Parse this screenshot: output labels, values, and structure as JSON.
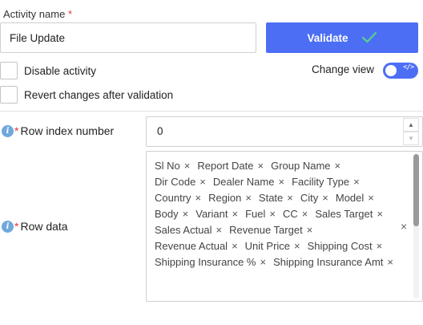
{
  "activity": {
    "label": "Activity name",
    "required_mark": "*",
    "value": "File Update"
  },
  "validate_button": {
    "label": "Validate",
    "icon": "check-icon",
    "color": "#4c6ef5"
  },
  "options": {
    "disable_activity": {
      "label": "Disable activity",
      "checked": false
    },
    "revert_changes": {
      "label": "Revert changes after validation",
      "checked": false
    }
  },
  "change_view": {
    "label": "Change view",
    "toggle_on": true,
    "toggle_icon_text": "</>"
  },
  "row_index": {
    "label": "Row index number",
    "required_mark": "*",
    "value": "0",
    "info_icon": "i"
  },
  "row_data": {
    "label": "Row data",
    "required_mark": "*",
    "info_icon": "i",
    "clear_icon": "×",
    "tags": [
      "Sl No",
      "Report Date",
      "Group Name",
      "Dir Code",
      "Dealer Name",
      "Facility Type",
      "Country",
      "Region",
      "State",
      "City",
      "Model",
      "Body",
      "Variant",
      "Fuel",
      "CC",
      "Sales Target",
      "Sales Actual",
      "Revenue Target",
      "Revenue Actual",
      "Unit Price",
      "Shipping Cost",
      "Shipping Insurance %",
      "Shipping Insurance Amt"
    ],
    "remove_icon": "×"
  }
}
